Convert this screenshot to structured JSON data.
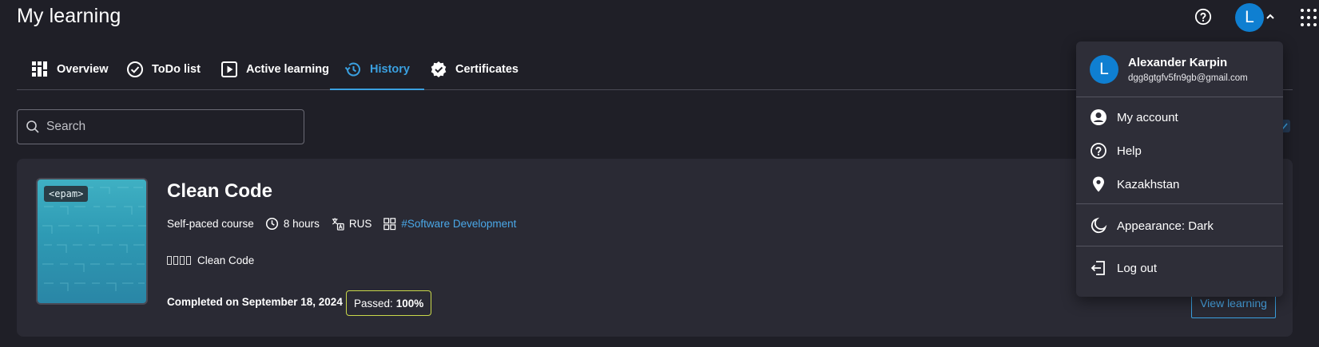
{
  "header": {
    "title": "My learning",
    "avatar_initial": "L"
  },
  "tabs": [
    {
      "label": "Overview",
      "icon": "grid-icon",
      "active": false
    },
    {
      "label": "ToDo list",
      "icon": "check-circle-icon",
      "active": false
    },
    {
      "label": "Active learning",
      "icon": "play-box-icon",
      "active": false
    },
    {
      "label": "History",
      "icon": "history-icon",
      "active": true
    },
    {
      "label": "Certificates",
      "icon": "certificate-badge-icon",
      "active": false
    }
  ],
  "search": {
    "placeholder": "Search",
    "value": ""
  },
  "course": {
    "thumbnail_logo": "<epam>",
    "title": "Clean Code",
    "type": "Self-paced course",
    "duration": "8 hours",
    "language": "RUS",
    "tag": "#Software Development",
    "localized_title": "Clean Code",
    "completed": "Completed on September 18, 2024",
    "passed_label": "Passed:",
    "passed_value": "100%",
    "view_button": "View learning"
  },
  "menu": {
    "initial": "L",
    "name": "Alexander Karpin",
    "email": "dgg8gtgfv5fn9gb@gmail.com",
    "items": [
      {
        "label": "My account",
        "icon": "account-circle-icon"
      },
      {
        "label": "Help",
        "icon": "help-circle-icon"
      },
      {
        "label": "Kazakhstan",
        "icon": "location-pin-icon"
      },
      {
        "label": "Appearance: Dark",
        "icon": "moon-icon"
      },
      {
        "label": "Log out",
        "icon": "logout-icon"
      }
    ]
  },
  "colors": {
    "background": "#1f1f27",
    "card": "#2a2a34",
    "accent": "#3aa0e0",
    "avatar": "#0f7fd1",
    "passed_border": "#c9d84a"
  }
}
